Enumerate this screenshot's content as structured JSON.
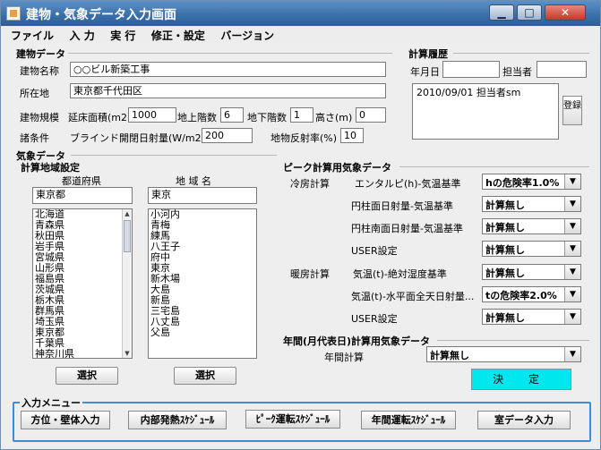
{
  "window": {
    "title": "建物・気象データ入力画面",
    "min_glyph": "▁",
    "max_glyph": "□",
    "close_glyph": "✕"
  },
  "menubar": [
    "ファイル",
    "入 力",
    "実 行",
    "修正・設定",
    "バージョン"
  ],
  "building": {
    "section_title": "建物データ",
    "name_label": "建物名称",
    "name_value": "○○ビル新築工事",
    "location_label": "所在地",
    "location_value": "東京都千代田区",
    "scale_label": "建物規模",
    "floor_area_label": "延床面積(m2)",
    "floor_area_value": "1000",
    "above_floors_label": "地上階数",
    "above_floors_value": "6",
    "below_floors_label": "地下階数",
    "below_floors_value": "1",
    "height_label": "高さ(m)",
    "height_value": "0",
    "conditions_label": "諸条件",
    "blind_label": "ブラインド開閉日射量(W/m2)",
    "blind_value": "200",
    "ground_label": "地物反射率(%)",
    "ground_value": "10"
  },
  "history": {
    "section_title": "計算履歴",
    "date_label": "年月日",
    "date_value": "",
    "person_label": "担当者",
    "person_value": "",
    "log_entries": [
      "2010/09/01 担当者sm"
    ],
    "register_label": "登録"
  },
  "weather": {
    "section_title": "気象データ",
    "area_title": "計算地域設定",
    "prefecture_header": "都道府県",
    "region_header": "地 域 名",
    "prefecture_value": "東京都",
    "region_value": "東京",
    "prefectures": [
      "北海道",
      "青森県",
      "秋田県",
      "岩手県",
      "宮城県",
      "山形県",
      "福島県",
      "茨城県",
      "栃木県",
      "群馬県",
      "埼玉県",
      "東京都",
      "千葉県",
      "神奈川県"
    ],
    "regions": [
      "小河内",
      "青梅",
      "練馬",
      "八王子",
      "府中",
      "東京",
      "新木場",
      "大島",
      "新島",
      "三宅島",
      "八丈島",
      "父島"
    ],
    "select_pref_label": "選択",
    "select_region_label": "選択"
  },
  "peak": {
    "section_title": "ピーク計算用気象データ",
    "cooling_label": "冷房計算",
    "heating_label": "暖房計算",
    "rows": [
      {
        "label": "エンタルピ(h)-気温基準",
        "value": "hの危険率1.0%"
      },
      {
        "label": "円柱面日射量-気温基準",
        "value": "計算無し"
      },
      {
        "label": "円柱南面日射量-気温基準",
        "value": "計算無し"
      },
      {
        "label": "USER設定",
        "value": "計算無し"
      },
      {
        "label": "気温(t)-絶対湿度基準",
        "value": "計算無し"
      },
      {
        "label": "気温(t)-水平面全天日射量...",
        "value": "tの危険率2.0%"
      },
      {
        "label": "USER設定",
        "value": "計算無し"
      }
    ]
  },
  "annual": {
    "section_title": "年間(月代表日)計算用気象データ",
    "label": "年間計算",
    "value": "計算無し"
  },
  "decide_label": "決 定",
  "input_menu": {
    "title": "入力メニュー",
    "buttons": [
      "方位・壁体入力",
      "内部発熱ｽｹｼﾞｭｰﾙ",
      "ﾋﾟｰｸ運転ｽｹｼﾞｭｰﾙ",
      "年間運転ｽｹｼﾞｭｰﾙ",
      "室データ入力"
    ]
  },
  "colors": {
    "title_bar": "#3a6ea8",
    "decide_button": "#00e8ee",
    "menu_frame": "#3c8dd6"
  }
}
